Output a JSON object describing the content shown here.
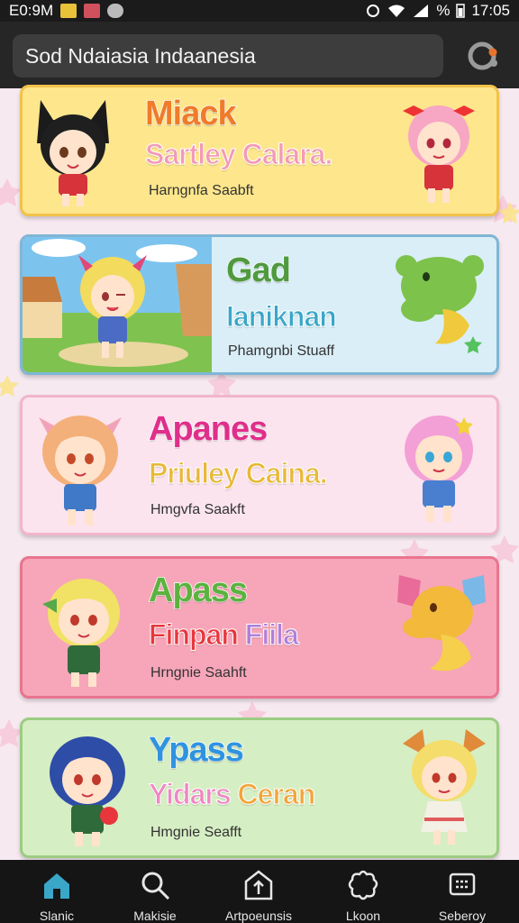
{
  "status_bar": {
    "left_text": "E0:9M",
    "right_text": "%",
    "time": "17:05"
  },
  "search": {
    "text": "Sod Ndaiasia Indaanesia"
  },
  "cards": [
    {
      "title": "Miack",
      "subtitle": "Sartley Calara.",
      "small": "Harngnfa Saabft"
    },
    {
      "title": "Gad",
      "subtitle": "Ianiknan",
      "small": "Phamgnbi Stuaff"
    },
    {
      "title": "Apanes",
      "subtitle": "Priuley Caina.",
      "small": "Hmgvfa Saakft"
    },
    {
      "title": "Apass",
      "subtitle_a": "Finpan",
      "subtitle_b": "Fiila",
      "small": "Hrngnie Saahft"
    },
    {
      "title": "Ypass",
      "subtitle_a": "Yidars",
      "subtitle_b": "Ceran",
      "small": "Hmgnie Seafft"
    }
  ],
  "nav": [
    {
      "label": "Slanic",
      "icon": "home-icon"
    },
    {
      "label": "Makisie",
      "icon": "search-icon"
    },
    {
      "label": "Artpoeunsis",
      "icon": "upload-icon"
    },
    {
      "label": "Lkoon",
      "icon": "puzzle-icon"
    },
    {
      "label": "Seberoy",
      "icon": "grid-icon"
    }
  ],
  "colors": {
    "header": "#262626",
    "navbar": "#151515",
    "accent": "#3aa6c8"
  }
}
